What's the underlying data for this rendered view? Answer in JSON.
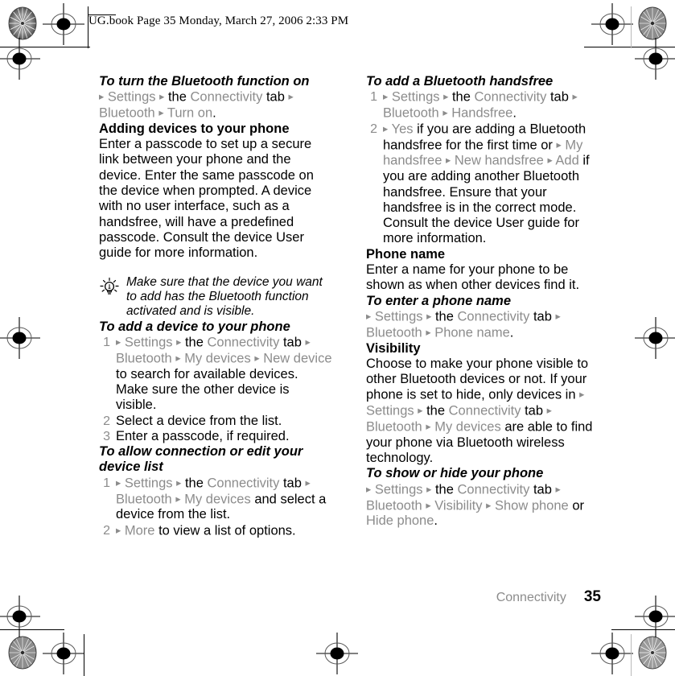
{
  "header": {
    "text": "UG.book  Page 35  Monday, March 27, 2006  2:33 PM"
  },
  "footer": {
    "section": "Connectivity",
    "page_number": "35"
  },
  "colors": {
    "menu_item_gray": "#8c8c8c",
    "body_black": "#000000",
    "background": "#ffffff"
  },
  "left_column": {
    "s1": {
      "heading": "To turn the Bluetooth function on",
      "path": {
        "a1": "▸",
        "settings": "Settings",
        "a2": "▸",
        "the": "the",
        "connectivity": "Connectivity",
        "tab": "tab",
        "a3": "▸",
        "bluetooth": "Bluetooth",
        "a4": "▸",
        "turn_on": "Turn on",
        "period": "."
      }
    },
    "s2": {
      "heading": "Adding devices to your phone",
      "body": "Enter a passcode to set up a secure link between your phone and the device. Enter the same passcode on the device when prompted. A device with no user interface, such as a handsfree, will have a predefined passcode. Consult the device User guide for more information."
    },
    "note": {
      "icon": "lightbulb-tip-icon",
      "text": "Make sure that the device you want to add has the Bluetooth function activated and is visible."
    },
    "s3": {
      "heading": "To add a device to your phone",
      "step1": {
        "num": "1",
        "a1": "▸",
        "settings": "Settings",
        "a2": "▸",
        "the": "the",
        "connectivity": "Connectivity",
        "tab": "tab",
        "a3": "▸",
        "bluetooth": "Bluetooth",
        "a4": "▸",
        "my_devices": "My devices",
        "a5": "▸",
        "new_device": "New device",
        "tail": "to search for available devices. Make sure the other device is visible."
      },
      "step2": {
        "num": "2",
        "text": "Select a device from the list."
      },
      "step3": {
        "num": "3",
        "text": "Enter a passcode, if required."
      }
    },
    "s4": {
      "heading": "To allow connection or edit your device list",
      "step1": {
        "num": "1",
        "a1": "▸",
        "settings": "Settings",
        "a2": "▸",
        "the": "the",
        "connectivity": "Connectivity",
        "tab": "tab",
        "a3": "▸",
        "bluetooth": "Bluetooth",
        "a4": "▸",
        "my_devices": "My devices",
        "tail": "and select a device from the list."
      },
      "step2": {
        "num": "2",
        "a1": "▸",
        "more": "More",
        "tail": "to view a list of options."
      }
    }
  },
  "right_column": {
    "s1": {
      "heading": "To add a Bluetooth handsfree",
      "step1": {
        "num": "1",
        "a1": "▸",
        "settings": "Settings",
        "a2": "▸",
        "the": "the",
        "connectivity": "Connectivity",
        "tab": "tab",
        "a3": "▸",
        "bluetooth": "Bluetooth",
        "a4": "▸",
        "handsfree": "Handsfree",
        "period": "."
      },
      "step2": {
        "num": "2",
        "a1": "▸",
        "yes": "Yes",
        "mid1": "if you are adding a Bluetooth handsfree for the first time or",
        "a2": "▸",
        "my_handsfree": "My handsfree",
        "a3": "▸",
        "new_handsfree": "New handsfree",
        "a4": "▸",
        "add": "Add",
        "tail": "if you are adding another Bluetooth handsfree. Ensure that your handsfree is in the correct mode. Consult the device User guide for more information."
      }
    },
    "s2": {
      "heading": "Phone name",
      "body": "Enter a name for your phone to be shown as when other devices find it."
    },
    "s3": {
      "heading": "To enter a phone name",
      "path": {
        "a1": "▸",
        "settings": "Settings",
        "a2": "▸",
        "the": "the",
        "connectivity": "Connectivity",
        "tab": "tab",
        "a3": "▸",
        "bluetooth": "Bluetooth",
        "a4": "▸",
        "phone_name": "Phone name",
        "period": "."
      }
    },
    "s4": {
      "heading": "Visibility",
      "body_lead": "Choose to make your phone visible to other Bluetooth devices or not. If your phone is set to hide, only devices in",
      "a1": "▸",
      "settings": "Settings",
      "a2": "▸",
      "the": "the",
      "connectivity": "Connectivity",
      "tab": "tab",
      "a3": "▸",
      "bluetooth": "Bluetooth",
      "a4": "▸",
      "my_devices": "My devices",
      "body_tail": "are able to find your phone via Bluetooth wireless technology."
    },
    "s5": {
      "heading": "To show or hide your phone",
      "path": {
        "a1": "▸",
        "settings": "Settings",
        "a2": "▸",
        "the": "the",
        "connectivity": "Connectivity",
        "tab": "tab",
        "a3": "▸",
        "bluetooth": "Bluetooth",
        "a4": "▸",
        "visibility": "Visibility",
        "a5": "▸",
        "show_phone": "Show phone",
        "or": "or",
        "hide_phone": "Hide phone",
        "period": "."
      }
    }
  }
}
